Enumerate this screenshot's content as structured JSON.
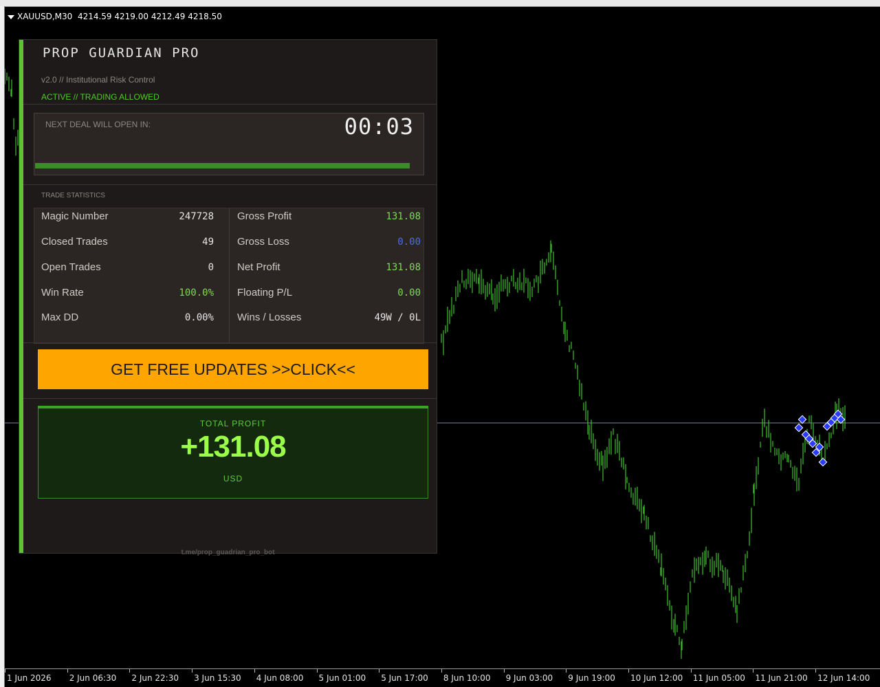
{
  "chart_header": {
    "symbol": "XAUUSD,M30",
    "ohlc": "4214.59 4219.00 4212.49 4218.50"
  },
  "colors": {
    "candle": "#3ec62b",
    "price_line": "#7a86a8",
    "accent": "#5fc234",
    "cta_background": "#ffa500",
    "trade_marker": "#2a3cff"
  },
  "x_axis_labels": [
    "1 Jun 2026",
    "2 Jun 06:30",
    "2 Jun 22:30",
    "3 Jun 15:30",
    "4 Jun 08:00",
    "5 Jun 01:00",
    "5 Jun 17:00",
    "8 Jun 10:00",
    "9 Jun 03:00",
    "9 Jun 19:00",
    "10 Jun 12:00",
    "11 Jun 05:00",
    "11 Jun 21:00",
    "12 Jun 14:00"
  ],
  "panel": {
    "title": "PROP GUARDIAN PRO",
    "version": "v2.0  //  Institutional Risk Control",
    "status": "ACTIVE  //  TRADING ALLOWED",
    "timer": {
      "label": "NEXT DEAL WILL OPEN IN:",
      "value": "00:03",
      "progress_percent": 100
    },
    "stats_label": "TRADE STATISTICS",
    "stats_left": [
      {
        "label": "Magic Number",
        "value": "247728"
      },
      {
        "label": "Closed Trades",
        "value": "49"
      },
      {
        "label": "Open Trades",
        "value": "0"
      },
      {
        "label": "Win Rate",
        "value": "100.0%"
      },
      {
        "label": "Max DD",
        "value": "0.00%"
      }
    ],
    "stats_right": [
      {
        "label": "Gross Profit",
        "value": "131.08"
      },
      {
        "label": "Gross Loss",
        "value": "0.00"
      },
      {
        "label": "Net Profit",
        "value": "131.08"
      },
      {
        "label": "Floating P/L",
        "value": "0.00"
      },
      {
        "label": "Wins / Losses",
        "value": "49W  /  0L"
      }
    ],
    "cta_label": "GET FREE UPDATES >>CLICK<<",
    "total_profit": {
      "label": "TOTAL PROFIT",
      "value": "+131.08",
      "currency": "USD"
    },
    "footer": "t.me/prop_guadrian_pro_bot"
  }
}
